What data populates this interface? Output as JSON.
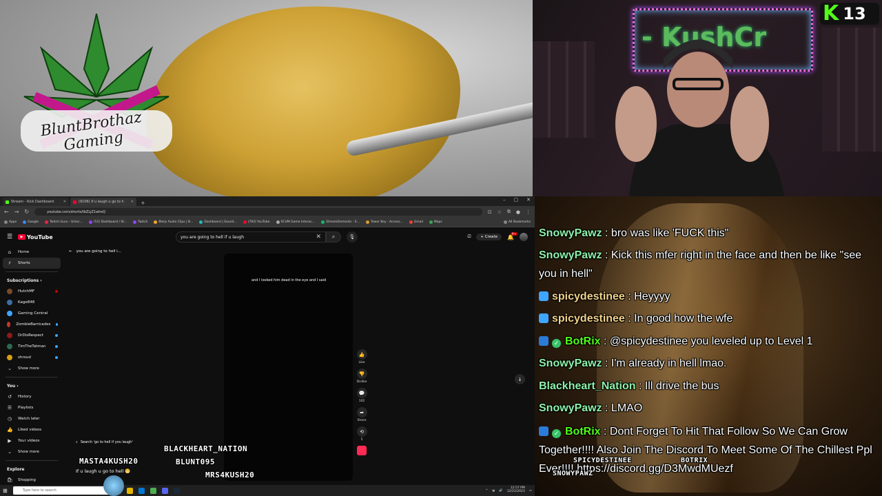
{
  "art": {
    "logo_text": "BluntBrothaz Gaming"
  },
  "cam": {
    "neon_text": "- KushCr",
    "kick_count": "13",
    "kick_letter": "K"
  },
  "browser": {
    "tabs": [
      {
        "label": "Stream - Kick Dashboard",
        "color": "#53fc18"
      },
      {
        "label": "(9106) If u laugh u go to h",
        "color": "#ff0033"
      }
    ],
    "new_tab": "+",
    "window_controls": [
      "–",
      "▢",
      "✕"
    ],
    "url": "youtube.com/shorts/tbZLjZ1whsQ",
    "bookmarks": [
      "Apps",
      "Google",
      "Twitch.Guru - Unloc...",
      "(53) Dashboard / St...",
      "Twitch",
      "Blerp Audio Clips | B...",
      "Dashboard | Sound...",
      "(783) YouTube",
      "SCUM Game Interac...",
      "StreamElements - S...",
      "Tower Key - Access...",
      "Gmail",
      "Maps"
    ],
    "bookmarks_all": "All Bookmarks"
  },
  "youtube": {
    "logo": "YouTube",
    "search_value": "you are going to hell if u laugh",
    "create": "Create",
    "bell_badge": "9+",
    "nav": [
      {
        "label": "Home",
        "icon": "⌂"
      },
      {
        "label": "Shorts",
        "icon": "⚡"
      }
    ],
    "subscriptions_heading": "Subscriptions ›",
    "subscriptions": [
      {
        "name": "HutchMF",
        "color": "#7a4b2a",
        "dot": "red"
      },
      {
        "name": "Kage848",
        "color": "#3b6ea5",
        "dot": ""
      },
      {
        "name": "Gaming Central",
        "color": "#3ea6ff",
        "dot": ""
      },
      {
        "name": "ZombieBarricades",
        "color": "#c0392b",
        "dot": "blue"
      },
      {
        "name": "DrDisRespect",
        "color": "#8a1c1c",
        "dot": "blue"
      },
      {
        "name": "TimTheTatman",
        "color": "#2d6a4f",
        "dot": "blue"
      },
      {
        "name": "shroud",
        "color": "#d4a017",
        "dot": "blue"
      }
    ],
    "show_more_1": "Show more",
    "you_heading": "You ›",
    "you_items": [
      {
        "label": "History",
        "icon": "↺"
      },
      {
        "label": "Playlists",
        "icon": "☰"
      },
      {
        "label": "Watch later",
        "icon": "◷"
      },
      {
        "label": "Liked videos",
        "icon": "👍"
      },
      {
        "label": "Your videos",
        "icon": "▶"
      },
      {
        "label": "Show more",
        "icon": "⌄"
      }
    ],
    "explore_heading": "Explore",
    "explore_items": [
      {
        "label": "Shopping"
      }
    ],
    "short_header": "you are going to hell i...",
    "caption": "and I looked him dead in the eye and I said",
    "actions": [
      {
        "name": "like",
        "icon": "👍",
        "label": "Like"
      },
      {
        "name": "dislike",
        "icon": "👎",
        "label": "Dislike"
      },
      {
        "name": "comments",
        "icon": "💬",
        "label": "102"
      },
      {
        "name": "share",
        "icon": "➦",
        "label": "Share"
      },
      {
        "name": "remix",
        "icon": "⟲",
        "label": "5"
      }
    ],
    "search_chip": "Search 'go to hell if you laugh'",
    "short_title": "If u laugh u go to hell 😬"
  },
  "taskbar": {
    "search_placeholder": "Type here to search",
    "time": "12:57 PM",
    "date": "12/21/2023"
  },
  "overlay_names": {
    "masta": "MASTA4KUSH20",
    "blackheart": "BLACKHEART_NATION",
    "blunt": "BLUNT095",
    "mrs": "MRS4KUSH20"
  },
  "chat": {
    "messages": [
      {
        "user": "SnowyPawz",
        "color": "#8ef0a8",
        "text": "bro was like 'FUCK this\""
      },
      {
        "user": "SnowyPawz",
        "color": "#8ef0a8",
        "text": "Kick this mfer right in the face and then be like \"see you in hell\""
      },
      {
        "user": "spicydestinee",
        "color": "#f3d38a",
        "text": "Heyyyy",
        "badge": "#3ea6ff"
      },
      {
        "user": "spicydestinee",
        "color": "#f3d38a",
        "text": "In good how the wfe",
        "badge": "#3ea6ff"
      },
      {
        "user": "BotRix",
        "color": "#53fc18",
        "text": "@spicydestinee you leveled up to Level 1",
        "badge": "#2b7bd8",
        "check": true
      },
      {
        "user": "SnowyPawz",
        "color": "#8ef0a8",
        "text": "I'm already in hell lmao."
      },
      {
        "user": "Blackheart_Nation",
        "color": "#8ef0a8",
        "text": "Ill drive the bus"
      },
      {
        "user": "SnowyPawz",
        "color": "#8ef0a8",
        "text": "LMAO"
      },
      {
        "user": "BotRix",
        "color": "#53fc18",
        "text": "Dont Forget To Hit That Follow So We Can Grow Together!!!! Also Join The Discord To Meet Some Of The Chillest Ppl Ever!!!! https://discord.gg/D3MwdMUezf",
        "badge": "#2b7bd8",
        "check": true
      }
    ],
    "footer_names": [
      "SPICYDESTINEE",
      "BOTRIX",
      "SNOWYPAWZ"
    ]
  }
}
